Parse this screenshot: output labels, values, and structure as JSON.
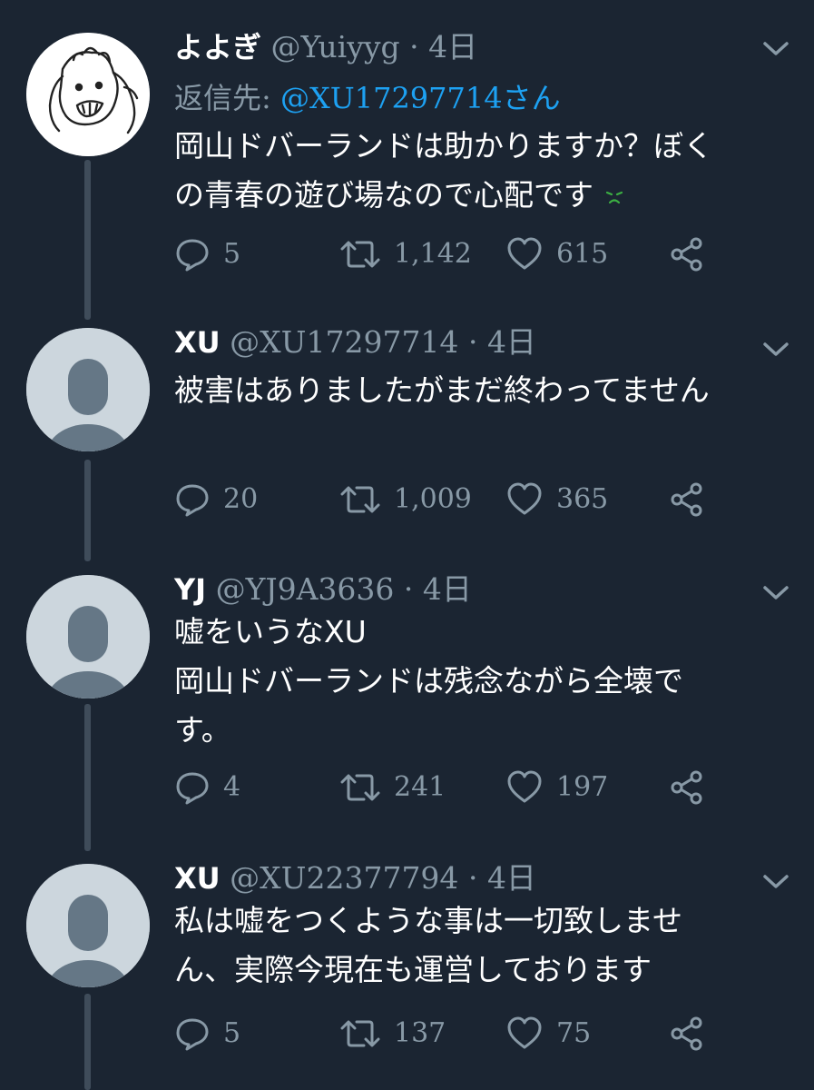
{
  "colors": {
    "background": "#1b2532",
    "secondary_text": "#8899a6",
    "link": "#1da1f2",
    "thread_line": "#3f4c5a",
    "default_avatar_bg": "#ccd6dd",
    "default_avatar_fg": "#657786"
  },
  "tweets": [
    {
      "name": "よよぎ",
      "handle": "@Yuiyyg",
      "dot": "·",
      "time": "4日",
      "reply_label": "返信先: ",
      "reply_mention": "@XU17297714さん",
      "lines": [
        "岡山ドバーランドは助かりますか？ぼく",
        "の青春の遊び場なので心配です"
      ],
      "emoji": "worried-face-icon",
      "replies": "5",
      "retweets": "1,142",
      "likes": "615"
    },
    {
      "name": "XU",
      "handle": "@XU17297714",
      "dot": "·",
      "time": "4日",
      "lines": [
        "被害はありましたがまだ終わってません"
      ],
      "replies": "20",
      "retweets": "1,009",
      "likes": "365"
    },
    {
      "name": "YJ",
      "handle": "@YJ9A3636",
      "dot": "·",
      "time": "4日",
      "lines": [
        "嘘をいうなXU",
        "岡山ドバーランドは残念ながら全壊で",
        "す。"
      ],
      "replies": "4",
      "retweets": "241",
      "likes": "197"
    },
    {
      "name": "XU",
      "handle": "@XU22377794",
      "dot": "·",
      "time": "4日",
      "lines": [
        "私は嘘をつくような事は一切致しませ",
        "ん、実際今現在も運営しております"
      ],
      "replies": "5",
      "retweets": "137",
      "likes": "75"
    }
  ]
}
